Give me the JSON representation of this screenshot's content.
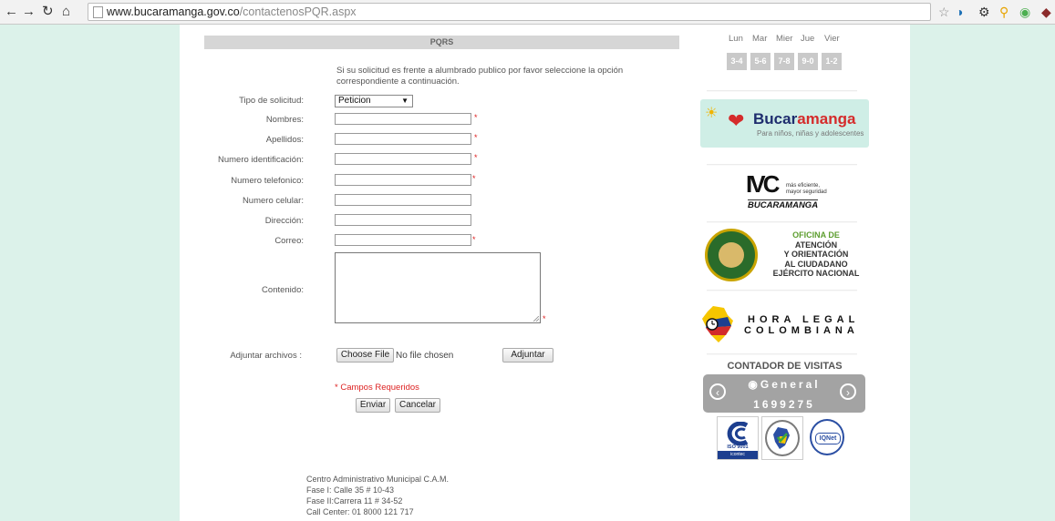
{
  "browser": {
    "url_domain": "www.bucaramanga.gov.co",
    "url_path": "/contactenosPQR.aspx",
    "icons": [
      "back-icon",
      "forward-icon",
      "reload-icon",
      "home-icon",
      "star-icon"
    ]
  },
  "form": {
    "header": "PQRS",
    "notice": "Si su solicitud es frente a alumbrado publico por favor seleccione la opción correspondiente a continuación.",
    "fields": {
      "tipo_label": "Tipo de solicitud:",
      "tipo_value": "Peticion",
      "nombres_label": "Nombres:",
      "apellidos_label": "Apellidos:",
      "identificacion_label": "Numero identificación:",
      "telefono_label": "Numero telefonico:",
      "celular_label": "Numero celular:",
      "direccion_label": "Dirección:",
      "correo_label": "Correo:",
      "contenido_label": "Contenido:",
      "adjuntar_label": "Adjuntar archivos :"
    },
    "required_mark": "*",
    "choose_file": "Choose File",
    "no_file": "No file chosen",
    "adjuntar_button": "Adjuntar",
    "required_note": "* Campos Requeridos",
    "enviar": "Enviar",
    "cancelar": "Cancelar"
  },
  "footer": {
    "line1": "Centro Administrativo Municipal C.A.M.",
    "line2": "Fase I: Calle 35 # 10-43",
    "line3": "Fase II:Carrera 11 # 34-52",
    "line4": "Call Center: 01 8000 121 717"
  },
  "sidebar": {
    "days": [
      "Lun",
      "Mar",
      "Mier",
      "Jue",
      "Vier"
    ],
    "plates": [
      "3-4",
      "5-6",
      "7-8",
      "9-0",
      "1-2"
    ],
    "buca_banner": {
      "name_a": "Bucar",
      "name_b": "amanga",
      "sub": "Para niños, niñas y adolescentes"
    },
    "ivc_banner": {
      "logo": "IVC",
      "tag1": "más eficiente,",
      "tag2": "mayor seguridad",
      "city": "BUCARAMANGA"
    },
    "oficina_banner": {
      "l1": "OFICINA DE",
      "l2": "ATENCIÓN",
      "l3": "Y ORIENTACIÓN",
      "l4": "AL CIUDADANO",
      "l5": "EJÉRCITO NACIONAL"
    },
    "hora_banner": {
      "l1": "HORA LEGAL",
      "l2": "COLOMBIANA"
    },
    "counter": {
      "title": "CONTADOR DE VISITAS",
      "label": "General",
      "value": "1699275"
    },
    "certs": {
      "iso": "ISO 9001",
      "icontec": "icontec",
      "iqnet": "IQNet"
    }
  },
  "colors": {
    "side_bg": "#dcf2ea",
    "required": "#dd2222",
    "counter_bg": "#a3a3a3"
  }
}
